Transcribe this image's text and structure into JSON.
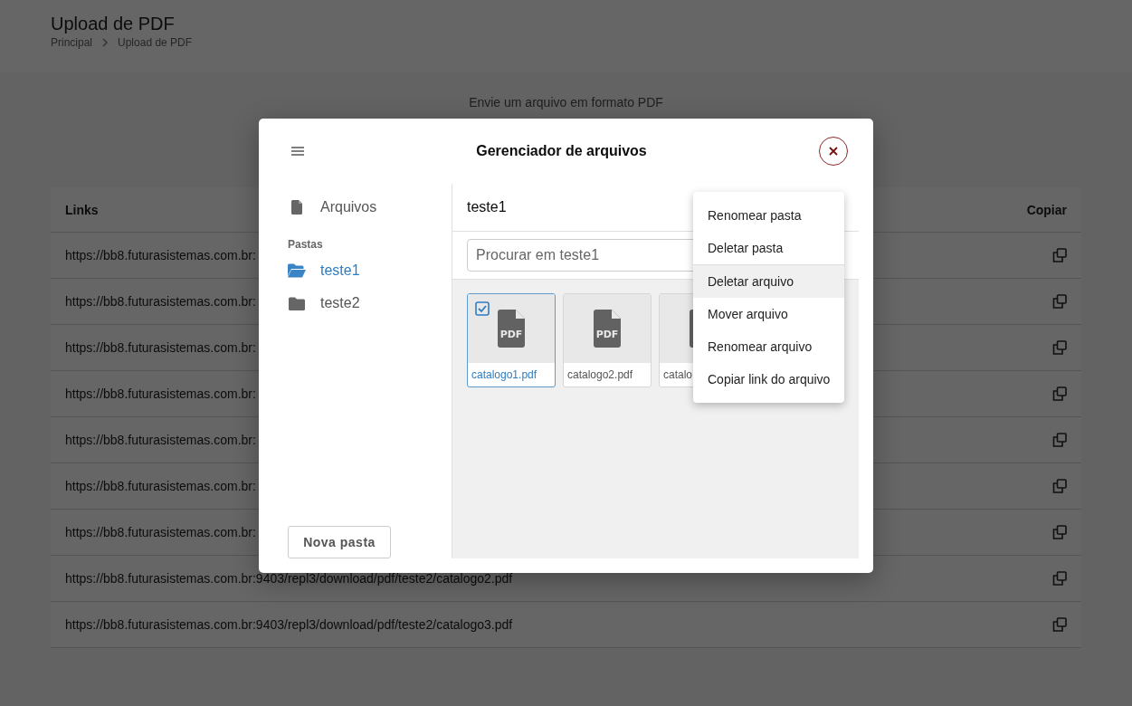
{
  "page": {
    "title": "Upload de PDF",
    "breadcrumb": [
      {
        "label": "Principal"
      },
      {
        "label": "Upload de PDF"
      }
    ],
    "instruction": "Envie um arquivo em formato PDF"
  },
  "links_table": {
    "columns": [
      "Links",
      "Copiar"
    ],
    "rows": [
      {
        "link": "https://bb8.futurasistemas.com.br:"
      },
      {
        "link": "https://bb8.futurasistemas.com.br:"
      },
      {
        "link": "https://bb8.futurasistemas.com.br:"
      },
      {
        "link": "https://bb8.futurasistemas.com.br:"
      },
      {
        "link": "https://bb8.futurasistemas.com.br:"
      },
      {
        "link": "https://bb8.futurasistemas.com.br:"
      },
      {
        "link": "https://bb8.futurasistemas.com.br:"
      },
      {
        "link": "https://bb8.futurasistemas.com.br:9403/repl3/download/pdf/teste2/catalogo2.pdf"
      },
      {
        "link": "https://bb8.futurasistemas.com.br:9403/repl3/download/pdf/teste2/catalogo3.pdf"
      }
    ]
  },
  "file_manager": {
    "title": "Gerenciador de arquivos",
    "sidebar": {
      "root": "Arquivos",
      "section_label": "Pastas",
      "folders": [
        {
          "name": "teste1",
          "selected": true
        },
        {
          "name": "teste2",
          "selected": false
        }
      ],
      "new_folder_button": "Nova pasta"
    },
    "current_folder": "teste1",
    "search": {
      "placeholder": "Procurar em teste1"
    },
    "files": [
      {
        "name": "catalogo1.pdf",
        "badge": "PDF",
        "selected": true
      },
      {
        "name": "catalogo2.pdf",
        "badge": "PDF",
        "selected": false
      },
      {
        "name": "catalo",
        "selected": false
      }
    ],
    "context_menu": {
      "sections": [
        {
          "items": [
            {
              "label": "Renomear pasta",
              "highlighted": false
            },
            {
              "label": "Deletar pasta",
              "highlighted": false
            }
          ]
        },
        {
          "items": [
            {
              "label": "Deletar arquivo",
              "highlighted": true
            },
            {
              "label": "Mover arquivo",
              "highlighted": false
            },
            {
              "label": "Renomear arquivo",
              "highlighted": false
            },
            {
              "label": "Copiar link do arquivo",
              "highlighted": false
            }
          ]
        }
      ]
    }
  }
}
